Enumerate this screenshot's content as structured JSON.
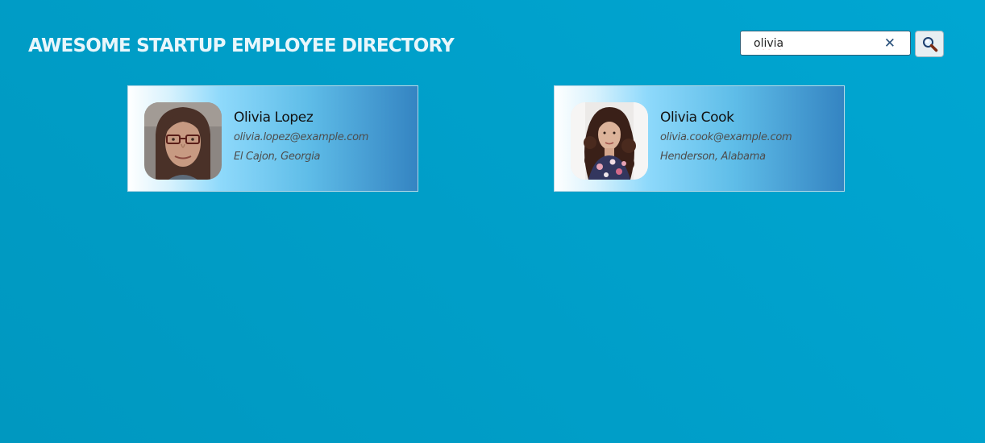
{
  "header": {
    "title": "AWESOME STARTUP EMPLOYEE DIRECTORY"
  },
  "search": {
    "value": "olivia",
    "clear_icon": "close-icon",
    "button_icon": "magnifier-icon"
  },
  "employees": [
    {
      "name": "Olivia Lopez",
      "email": "olivia.lopez@example.com",
      "location": "El Cajon, Georgia",
      "avatar": "photo of woman with glasses"
    },
    {
      "name": "Olivia Cook",
      "email": "olivia.cook@example.com",
      "location": "Henderson, Alabama",
      "avatar": "photo of woman with curly hair"
    }
  ],
  "colors": {
    "background": "#00a0cb",
    "title_text": "#e8f6fb",
    "card_gradient_start": "#ffffff",
    "card_gradient_end": "#3484c2"
  }
}
